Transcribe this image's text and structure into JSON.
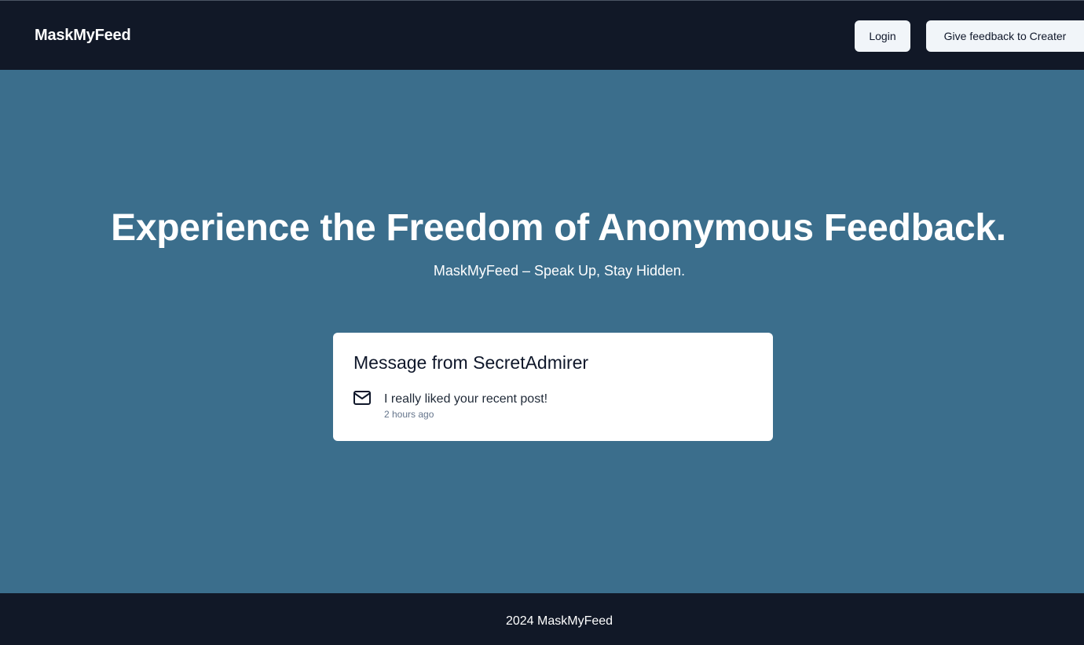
{
  "navbar": {
    "brand": "MaskMyFeed",
    "login_label": "Login",
    "feedback_label": "Give feedback to Creater"
  },
  "hero": {
    "title": "Experience the Freedom of Anonymous Feedback.",
    "subtitle": "MaskMyFeed – Speak Up, Stay Hidden."
  },
  "message_card": {
    "title": "Message from SecretAdmirer",
    "icon": "mail-icon",
    "content": "I really liked your recent post!",
    "received": "2 hours ago"
  },
  "footer": {
    "text": "2024 MaskMyFeed"
  },
  "colors": {
    "nav_background": "#111827",
    "hero_background": "#3b6e8c",
    "button_background": "#f1f5f9",
    "card_background": "#ffffff",
    "muted_text": "#64748b"
  }
}
